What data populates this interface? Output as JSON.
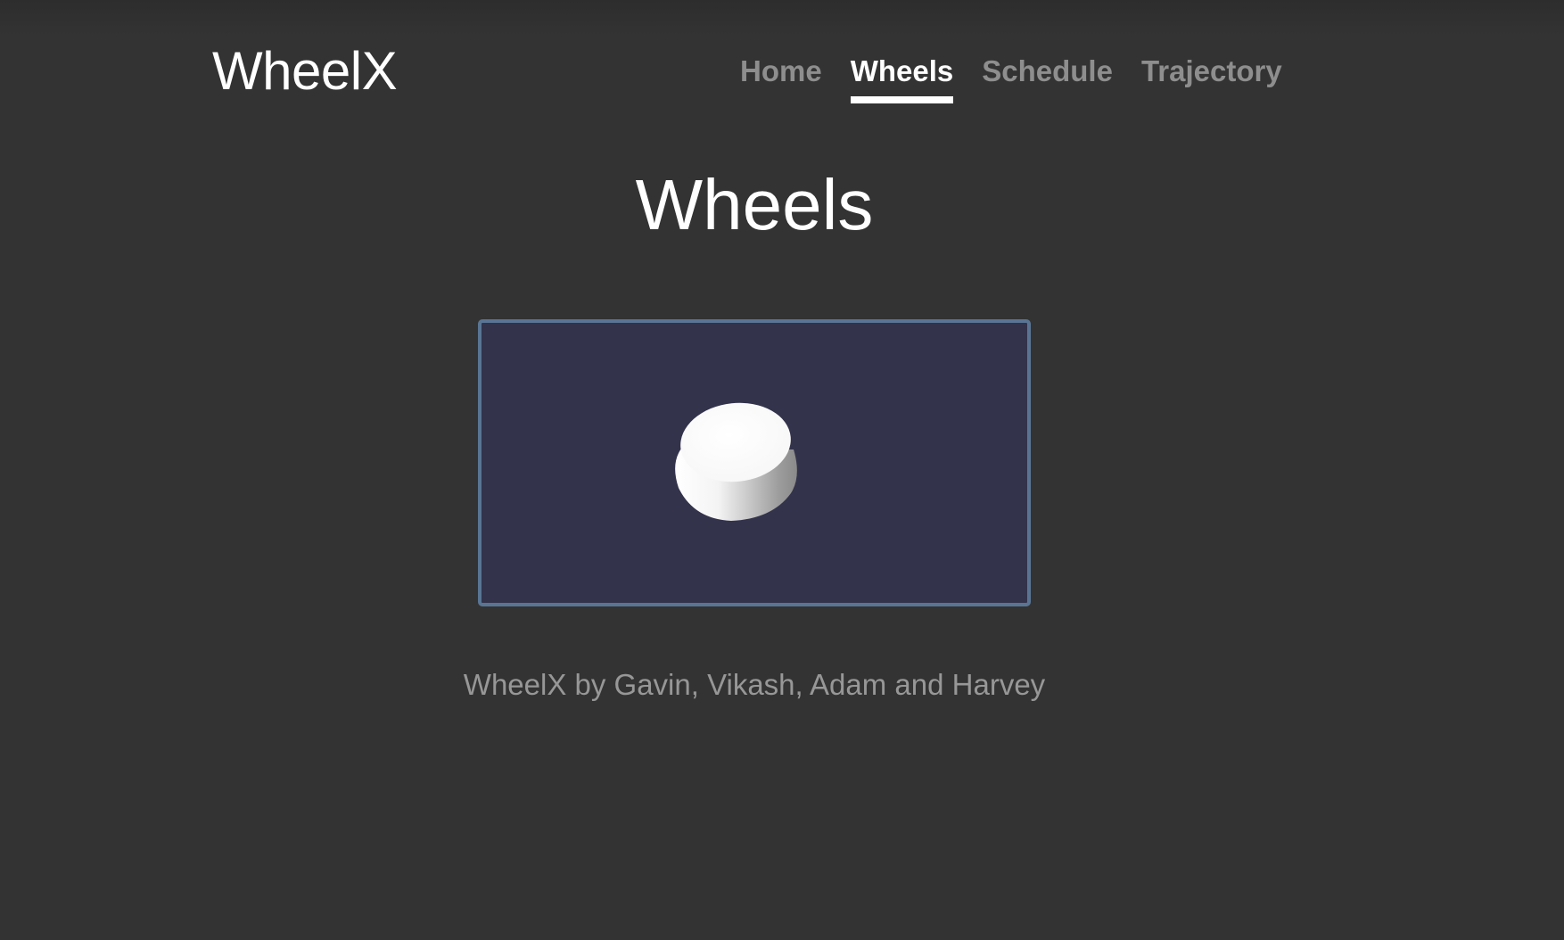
{
  "header": {
    "brand": "WheelX",
    "nav": [
      {
        "label": "Home",
        "active": false
      },
      {
        "label": "Wheels",
        "active": true
      },
      {
        "label": "Schedule",
        "active": false
      },
      {
        "label": "Trajectory",
        "active": false
      }
    ]
  },
  "main": {
    "title": "Wheels",
    "viewer": {
      "background_color": "#33334c",
      "border_color": "#5a7594",
      "model": "wheel-3d-model"
    },
    "credit": "WheelX by Gavin, Vikash, Adam and Harvey"
  },
  "colors": {
    "page_background": "#333333",
    "nav_inactive": "#8e8e8e",
    "nav_active": "#ffffff",
    "credit_text": "#979797"
  }
}
